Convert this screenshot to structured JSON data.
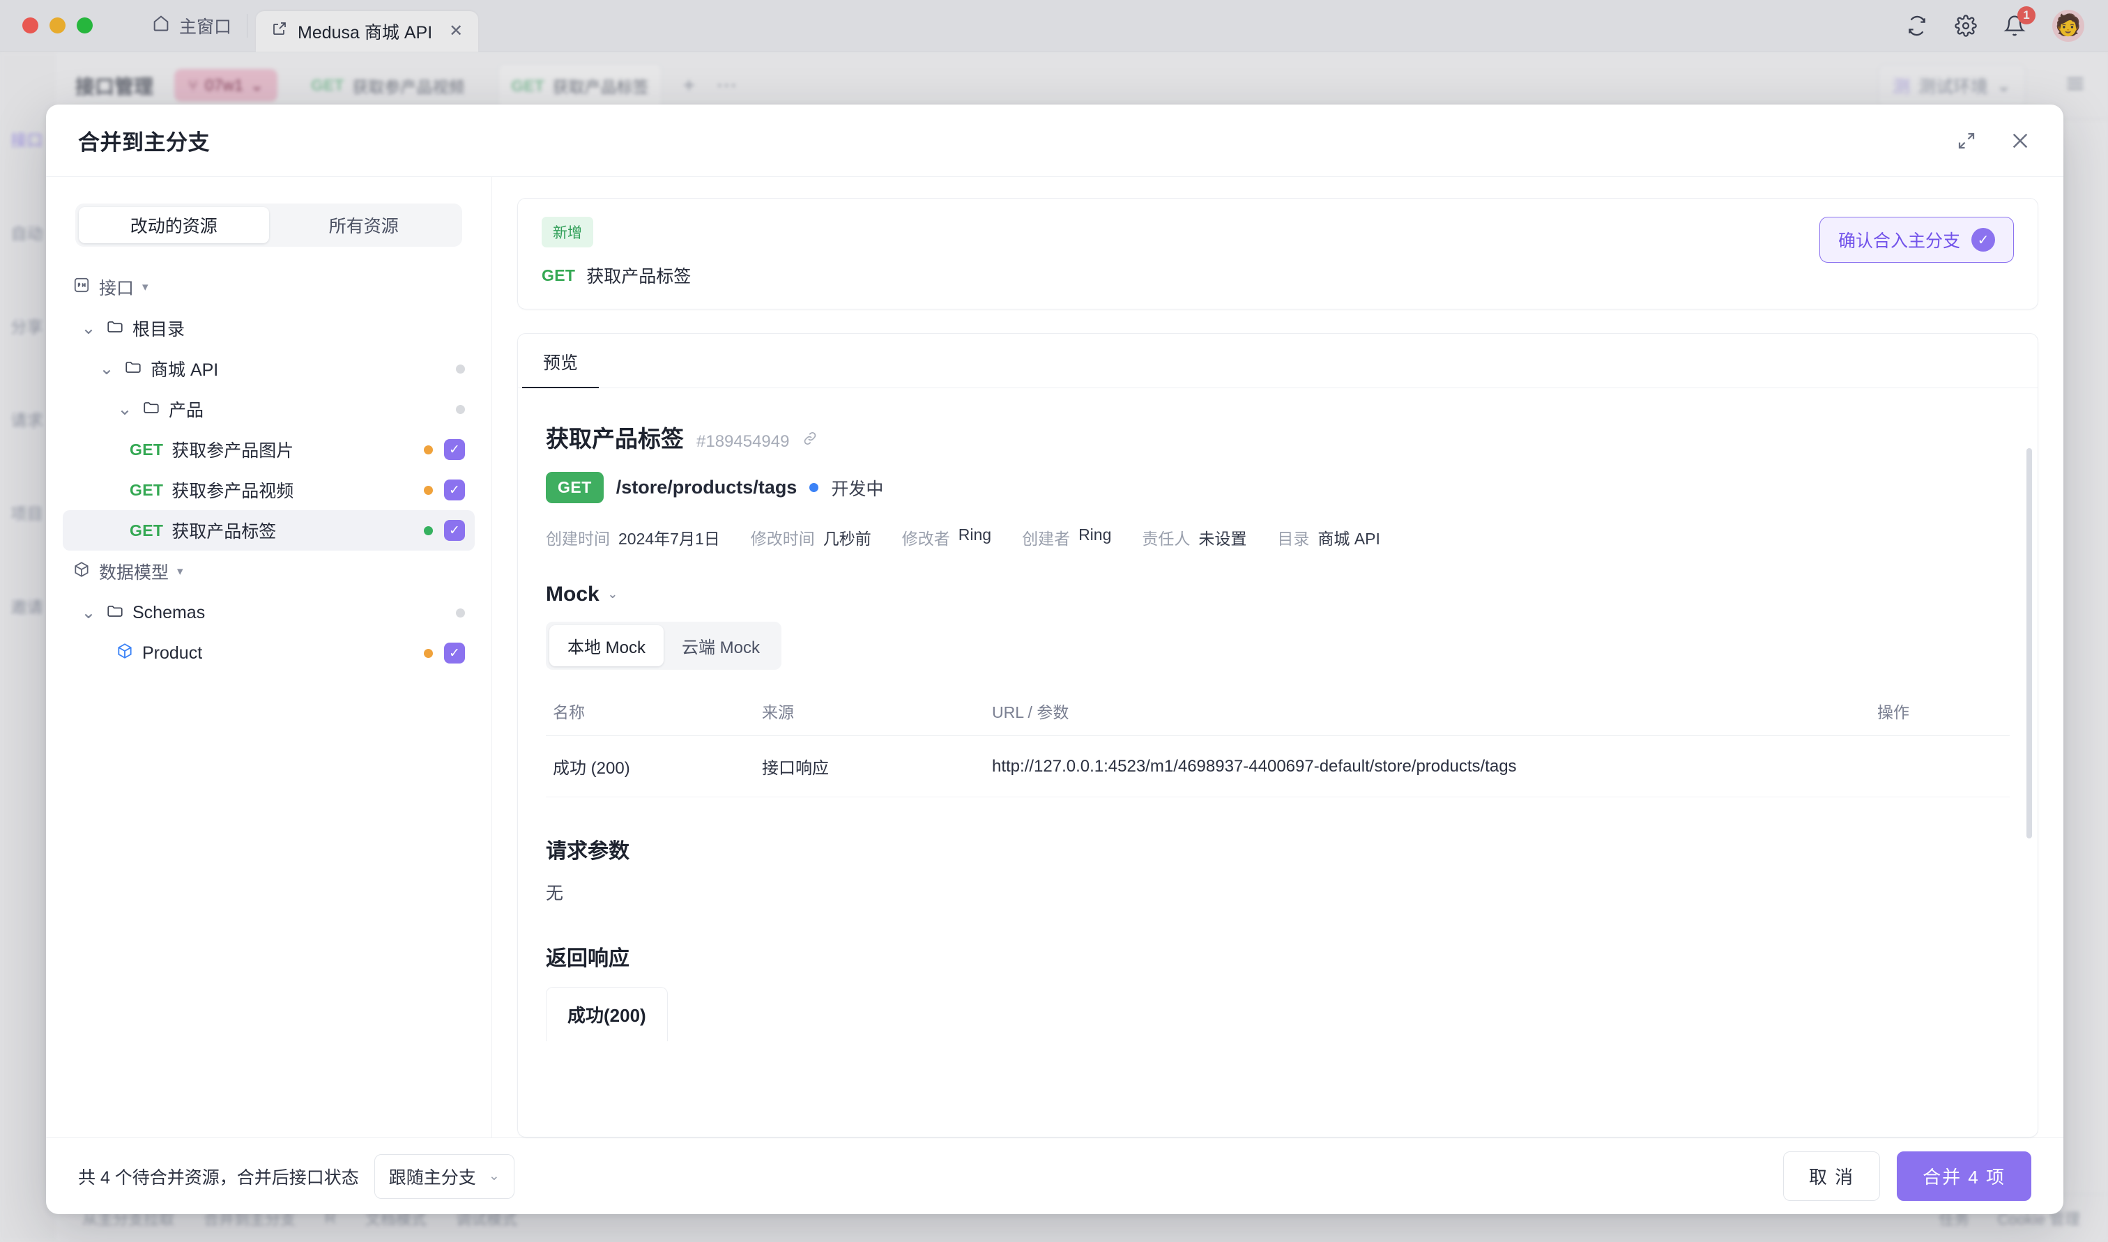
{
  "titlebar": {
    "home_tab": "主窗口",
    "home_icon": "home-icon",
    "project_tab": "Medusa 商城 API",
    "project_tab_icon": "external-link-icon",
    "close_tab_glyph": "✕",
    "refresh_icon": "refresh-icon",
    "settings_icon": "gear-icon",
    "notifications_icon": "bell-icon",
    "notification_count": "1",
    "avatar_glyph": "🧑"
  },
  "app_background": {
    "left_rail": [
      "接口",
      "自动",
      "分享",
      "请求",
      "项目",
      "邀请"
    ],
    "topbar_title": "接口管理",
    "branch_pill": "07w1",
    "open_tabs": [
      {
        "method": "GET",
        "name": "获取参产品视频"
      },
      {
        "method": "GET",
        "name": "获取产品标签"
      }
    ],
    "add_tab_glyph": "+",
    "more_tab_glyph": "⋯",
    "env_badge": "测",
    "env_name": "测试环境",
    "menu_icon": "hamburger-icon",
    "bottom_items": [
      "从主分支拉取",
      "合并到主分支",
      "R",
      "文档模式",
      "调试模式"
    ],
    "bottom_right_items": [
      "任务",
      "Cookie 管理"
    ]
  },
  "modal": {
    "title": "合并到主分支",
    "minimize_icon": "collapse-icon",
    "close_icon": "close-icon",
    "segments": [
      {
        "label": "改动的资源",
        "active": true
      },
      {
        "label": "所有资源",
        "active": false
      }
    ],
    "tree": [
      {
        "kind": "group",
        "icon": "api-icon",
        "label": "接口",
        "caret": "▾",
        "indent": 0
      },
      {
        "kind": "folder",
        "icon": "folder-icon",
        "label": "根目录",
        "indent": 1,
        "twisty": "⌄"
      },
      {
        "kind": "folder",
        "icon": "folder-icon",
        "label": "商城 API",
        "indent": 2,
        "twisty": "⌄",
        "dot": "#d8dade"
      },
      {
        "kind": "folder",
        "icon": "folder-icon",
        "label": "产品",
        "indent": 3,
        "twisty": "⌄",
        "dot": "#d8dade"
      },
      {
        "kind": "api",
        "method": "GET",
        "label": "获取参产品图片",
        "indent": 4,
        "dot": "#f0a23b",
        "checked": true
      },
      {
        "kind": "api",
        "method": "GET",
        "label": "获取参产品视频",
        "indent": 4,
        "dot": "#f0a23b",
        "checked": true
      },
      {
        "kind": "api",
        "method": "GET",
        "label": "获取产品标签",
        "indent": 4,
        "dot": "#35b15f",
        "checked": true,
        "selected": true
      },
      {
        "kind": "group",
        "icon": "cube-icon",
        "label": "数据模型",
        "caret": "▾",
        "indent": 0
      },
      {
        "kind": "folder",
        "icon": "folder-icon",
        "label": "Schemas",
        "indent": 1,
        "twisty": "⌄",
        "dot": "#d8dade"
      },
      {
        "kind": "schema",
        "icon": "cube-blue-icon",
        "label": "Product",
        "indent": 3,
        "dot": "#f0a23b",
        "checked": true
      }
    ],
    "diff_header": {
      "chip": "新增",
      "method": "GET",
      "name": "获取产品标签",
      "confirm_label": "确认合入主分支",
      "confirm_tick": "✓"
    },
    "preview": {
      "tab_label": "预览",
      "api_title": "获取产品标签",
      "api_id": "#189454949",
      "link_icon": "link-icon",
      "method": "GET",
      "path": "/store/products/tags",
      "status": "开发中",
      "status_color": "#3b82f6",
      "meta": [
        {
          "key": "创建时间",
          "value": "2024年7月1日"
        },
        {
          "key": "修改时间",
          "value": "几秒前"
        },
        {
          "key": "修改者",
          "value": "Ring"
        },
        {
          "key": "创建者",
          "value": "Ring"
        },
        {
          "key": "责任人",
          "value": "未设置"
        },
        {
          "key": "目录",
          "value": "商城 API"
        }
      ],
      "mock": {
        "section_title": "Mock",
        "collapse_caret": "⌄",
        "tabs": [
          {
            "label": "本地 Mock",
            "active": true
          },
          {
            "label": "云端 Mock",
            "active": false
          }
        ],
        "columns": [
          "名称",
          "来源",
          "URL / 参数",
          "操作"
        ],
        "rows": [
          {
            "name": "成功 (200)",
            "source": "接口响应",
            "url": "http://127.0.0.1:4523/m1/4698937-4400697-default/store/products/tags",
            "op": ""
          }
        ]
      },
      "request_params": {
        "title": "请求参数",
        "empty": "无"
      },
      "response": {
        "title": "返回响应",
        "tabs": [
          "成功(200)"
        ]
      }
    },
    "footer": {
      "summary": "共 4 个待合并资源，合并后接口状态",
      "status_select": "跟随主分支",
      "status_caret": "⌄",
      "cancel_label": "取 消",
      "merge_label": "合并 4 项"
    }
  }
}
